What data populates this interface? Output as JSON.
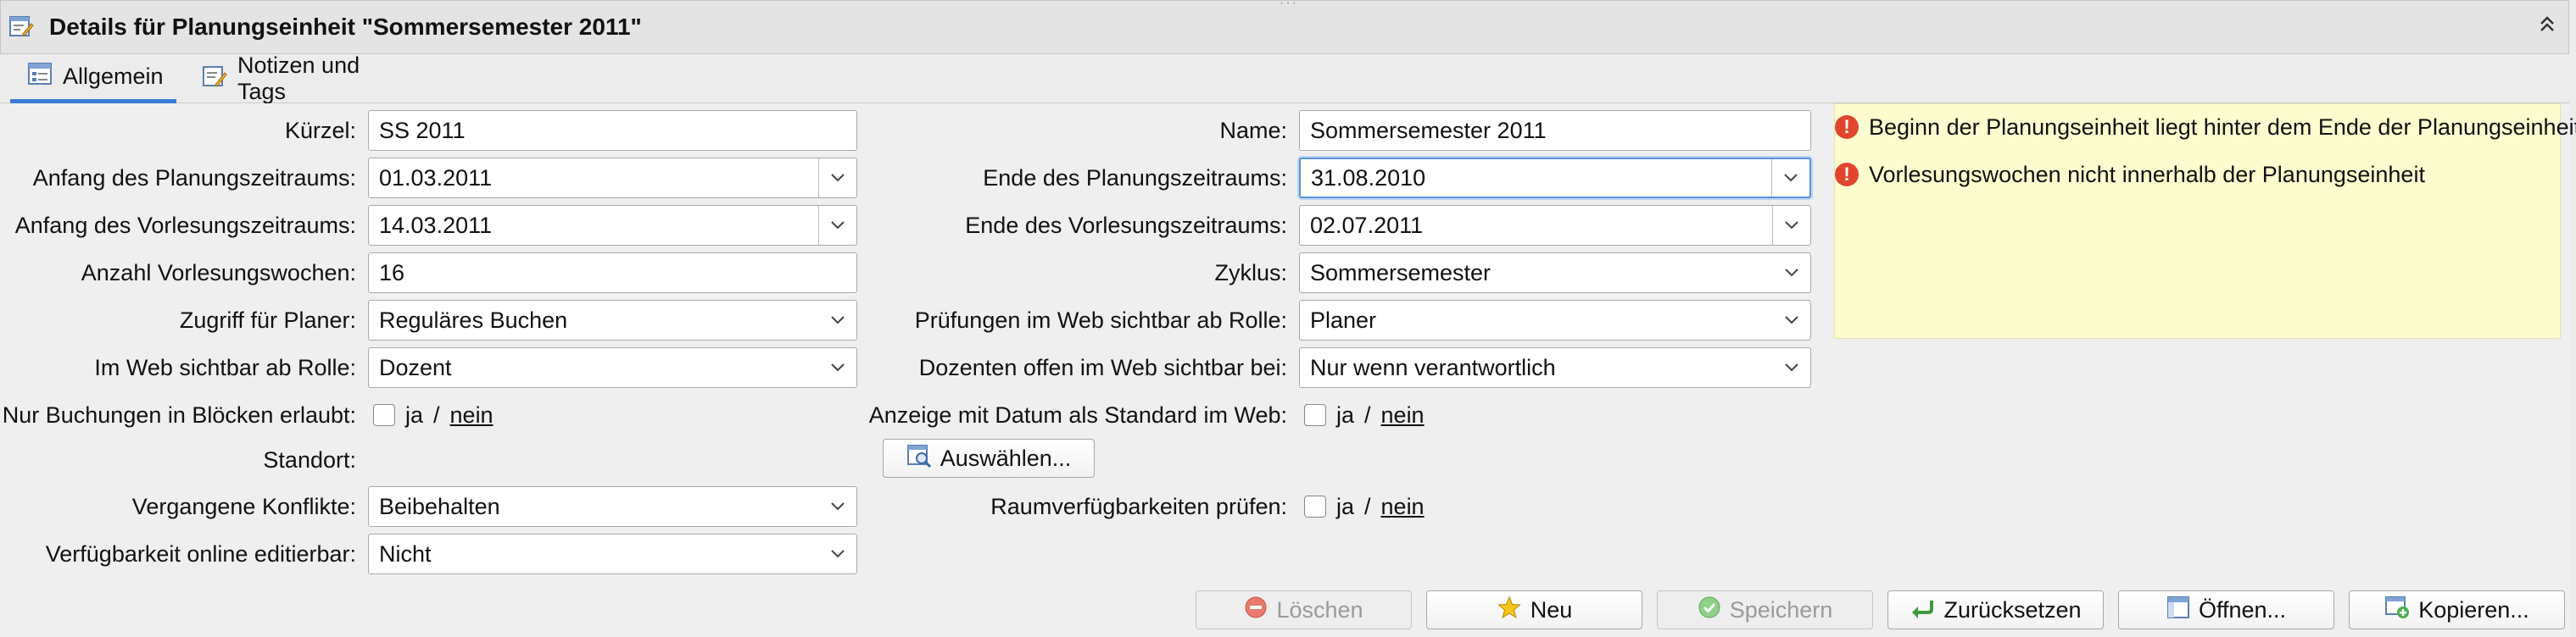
{
  "panel": {
    "title": "Details für Planungseinheit \"Sommersemester 2011\"",
    "grip": "···",
    "collapse_glyph": "«"
  },
  "tabs": [
    {
      "label": "Allgemein"
    },
    {
      "label": "Notizen und Tags"
    }
  ],
  "form": {
    "kuerzel": {
      "label": "Kürzel:",
      "value": "SS 2011"
    },
    "name": {
      "label": "Name:",
      "value": "Sommersemester 2011"
    },
    "anfang_planung": {
      "label": "Anfang des Planungszeitraums:",
      "value": "01.03.2011"
    },
    "ende_planung": {
      "label": "Ende des Planungszeitraums:",
      "value": "31.08.2010"
    },
    "anfang_vorlesung": {
      "label": "Anfang des Vorlesungszeitraums:",
      "value": "14.03.2011"
    },
    "ende_vorlesung": {
      "label": "Ende des Vorlesungszeitraums:",
      "value": "02.07.2011"
    },
    "anzahl_wochen": {
      "label": "Anzahl Vorlesungswochen:",
      "value": "16"
    },
    "zyklus": {
      "label": "Zyklus:",
      "value": "Sommersemester"
    },
    "zugriff": {
      "label": "Zugriff für Planer:",
      "value": "Reguläres Buchen"
    },
    "pruefungen_web": {
      "label": "Prüfungen im Web sichtbar ab Rolle:",
      "value": "Planer"
    },
    "web_sichtbar": {
      "label": "Im Web sichtbar ab Rolle:",
      "value": "Dozent"
    },
    "dozenten_offen": {
      "label": "Dozenten offen im Web sichtbar bei:",
      "value": "Nur wenn verantwortlich"
    },
    "nur_bloecke": {
      "label": "Nur Buchungen in Blöcken erlaubt:",
      "ja": "ja",
      "sep": "/",
      "nein": "nein"
    },
    "anzeige_datum": {
      "label": "Anzeige mit Datum als Standard im Web:",
      "ja": "ja",
      "sep": "/",
      "nein": "nein"
    },
    "standort": {
      "label": "Standort:",
      "button": "Auswählen..."
    },
    "vergangene": {
      "label": "Vergangene Konflikte:",
      "value": "Beibehalten"
    },
    "raumverf": {
      "label": "Raumverfügbarkeiten prüfen:",
      "ja": "ja",
      "sep": "/",
      "nein": "nein"
    },
    "verf_online": {
      "label": "Verfügbarkeit online editierbar:",
      "value": "Nicht"
    }
  },
  "messages": [
    "Beginn der Planungseinheit liegt hinter dem Ende der Planungseinheit",
    "Vorlesungswochen nicht innerhalb der Planungseinheit"
  ],
  "buttons": {
    "delete": "Löschen",
    "new": "Neu",
    "save": "Speichern",
    "reset": "Zurücksetzen",
    "open": "Öffnen...",
    "copy": "Kopieren..."
  },
  "colors": {
    "accent": "#3a7bd5",
    "error": "#e2452e",
    "message_bg": "#fdfccf",
    "save_green": "#3cb043"
  }
}
